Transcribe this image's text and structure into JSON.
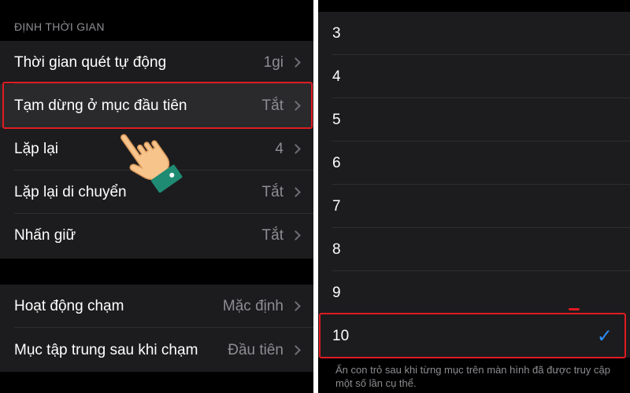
{
  "left": {
    "section_header": "ĐỊNH THỜI GIAN",
    "group1": [
      {
        "label": "Thời gian quét tự động",
        "value": "1gi"
      },
      {
        "label": "Tạm dừng ở mục đầu tiên",
        "value": "Tắt"
      },
      {
        "label": "Lặp lại",
        "value": "4"
      },
      {
        "label": "Lặp lại di chuyển",
        "value": "Tắt"
      },
      {
        "label": "Nhấn giữ",
        "value": "Tắt"
      }
    ],
    "group2": [
      {
        "label": "Hoạt động chạm",
        "value": "Mặc định"
      },
      {
        "label": "Mục tập trung sau khi chạm",
        "value": "Đầu tiên"
      }
    ]
  },
  "right": {
    "numbers": [
      "3",
      "4",
      "5",
      "6",
      "7",
      "8",
      "9",
      "10"
    ],
    "selected": "10",
    "check_icon": "checkmark-icon",
    "footer": "Ẩn con trỏ sau khi từng mục trên màn hình đã được truy cập một số lần cụ thể."
  },
  "colors": {
    "highlight_border": "#e01b22",
    "accent_check": "#2f8cf6",
    "cell_bg": "#1c1c1e",
    "secondary_text": "#8d8d92"
  },
  "icons": [
    "chevron-right-icon",
    "pointing-hand-icon",
    "checkmark-icon"
  ]
}
